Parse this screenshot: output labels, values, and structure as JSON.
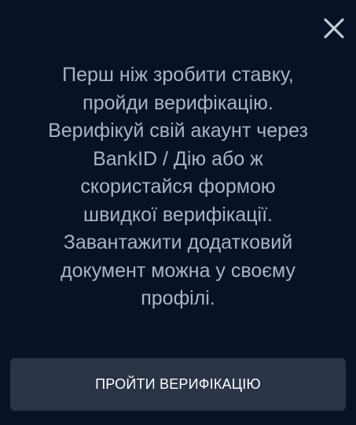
{
  "modal": {
    "close_icon": "close-icon",
    "message_lines": [
      "Перш ніж зробити ставку,",
      "пройди верифікацію.",
      "Верифікуй свій акаунт через",
      "BankID / Дію або ж",
      "скористайся формою",
      "швидкої верифікації.",
      "Завантажити додатковий",
      "документ можна у своєму",
      "профілі."
    ],
    "cta_label": "ПРОЙТИ ВЕРИФІКАЦІЮ"
  },
  "colors": {
    "background": "#081226",
    "text": "#a9b4c6",
    "button": "#2a3446",
    "close": "#c4ccd8"
  }
}
